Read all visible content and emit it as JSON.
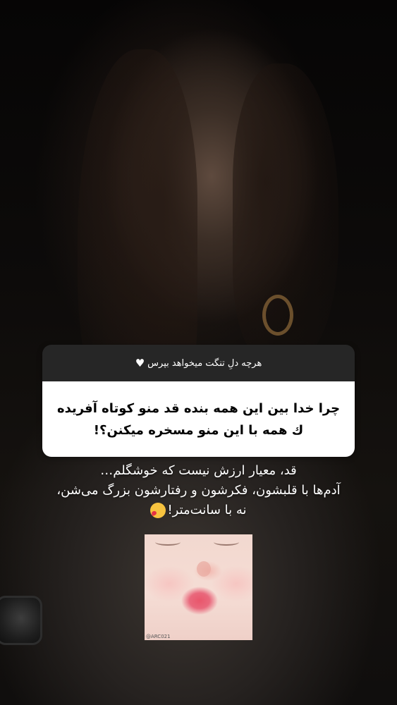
{
  "question_sticker": {
    "header": "هرچه دلِ تنگت میخواهد بپرس",
    "header_icon": "white-heart-icon",
    "question_line1": "چرا خدا بین این همه بنده قد منو کوتاه آفریده",
    "question_line2": "ك همه با این منو مسخره میکنن؟!"
  },
  "answer": {
    "line1": "قد، معیار ارزش نیست که خوشگلم…",
    "line2": "آدم‌ها با قلبشون، فکرشون و رفتارشون بزرگ می‌شن،",
    "line3": "نه با سانت‌متر!",
    "emoji": "kiss-emoji"
  },
  "image": {
    "watermark": "@ARC021"
  },
  "colors": {
    "sticker_header": "#262626",
    "sticker_body": "#ffffff",
    "text_on_photo": "#ffffff"
  }
}
